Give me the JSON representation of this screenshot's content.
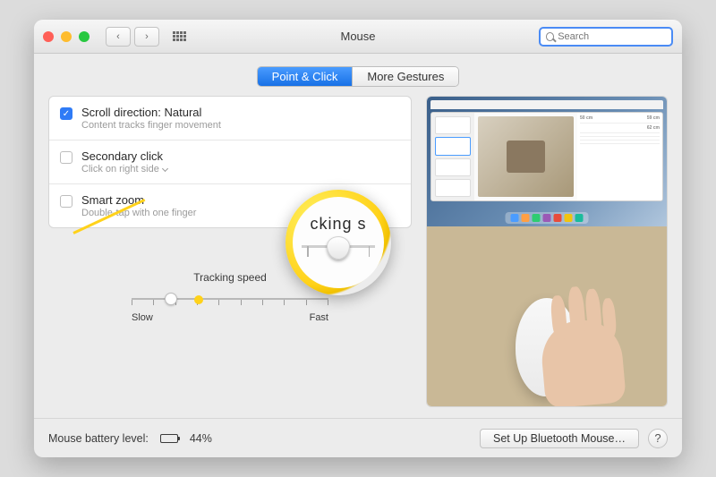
{
  "window": {
    "title": "Mouse"
  },
  "search": {
    "placeholder": "Search"
  },
  "tabs": {
    "point_click": "Point & Click",
    "more_gestures": "More Gestures"
  },
  "options": {
    "scroll": {
      "title": "Scroll direction: Natural",
      "sub": "Content tracks finger movement",
      "checked": true
    },
    "secondary": {
      "title": "Secondary click",
      "sub": "Click on right side",
      "checked": false
    },
    "zoom": {
      "title": "Smart zoom",
      "sub": "Double-tap with one finger",
      "checked": false
    }
  },
  "tracking": {
    "label": "Tracking speed",
    "slow": "Slow",
    "fast": "Fast"
  },
  "magnifier": {
    "text_fragment": "cking s"
  },
  "footer": {
    "battery_label": "Mouse battery level:",
    "battery_pct": "44%",
    "bluetooth_btn": "Set Up Bluetooth Mouse…",
    "help": "?"
  },
  "preview": {
    "info_labels": {
      "a": "50 cm",
      "b": "59 cm",
      "c": "62 cm"
    }
  }
}
